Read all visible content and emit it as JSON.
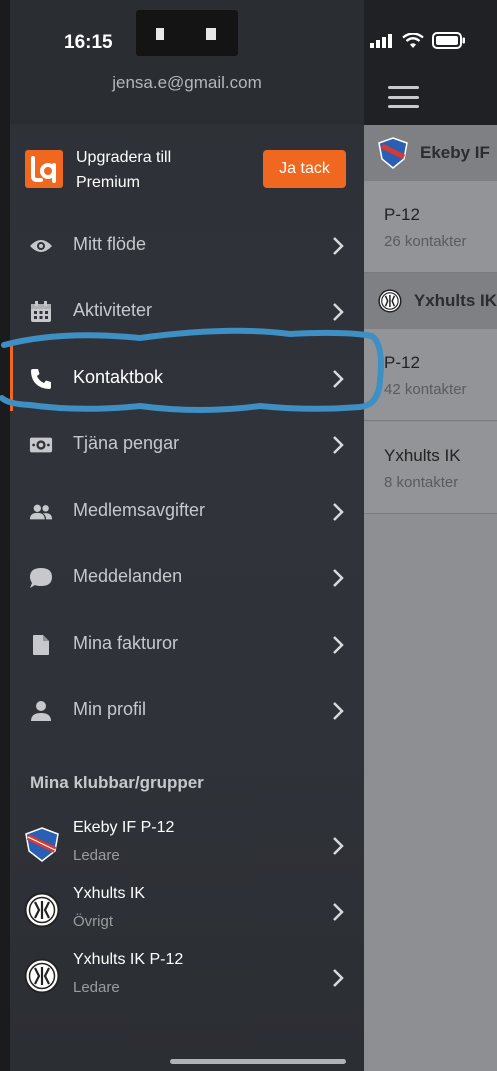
{
  "status_bar": {
    "time": "16:15"
  },
  "account": {
    "email": "jensa.e@gmail.com"
  },
  "premium": {
    "text": "Upgradera till Premium",
    "button_label": "Ja tack",
    "accent": "#f0671f"
  },
  "menu": {
    "items": [
      {
        "label": "Mitt flöde",
        "icon": "eye-icon"
      },
      {
        "label": "Aktiviteter",
        "icon": "calendar-icon"
      },
      {
        "label": "Kontaktbok",
        "icon": "phone-icon",
        "active": true
      },
      {
        "label": "Tjäna pengar",
        "icon": "money-icon"
      },
      {
        "label": "Medlemsavgifter",
        "icon": "people-icon"
      },
      {
        "label": "Meddelanden",
        "icon": "chat-bubble-icon"
      },
      {
        "label": "Mina fakturor",
        "icon": "document-icon"
      },
      {
        "label": "Min profil",
        "icon": "person-icon"
      }
    ]
  },
  "clubs_section": {
    "title": "Mina klubbar/grupper",
    "items": [
      {
        "name": "Ekeby IF P-12",
        "role": "Ledare",
        "icon": "ekeby-crest-icon"
      },
      {
        "name": "Yxhults IK",
        "role": "Övrigt",
        "icon": "yxhult-crest-icon"
      },
      {
        "name": "Yxhults IK P-12",
        "role": "Ledare",
        "icon": "yxhult-crest-icon"
      }
    ]
  },
  "contacts_panel": {
    "groups": [
      {
        "club": "Ekeby IF",
        "rows": [
          {
            "title": "P-12",
            "count": "26 kontakter"
          }
        ]
      },
      {
        "club": "Yxhults IK",
        "rows": [
          {
            "title": "P-12",
            "count": "42 kontakter"
          },
          {
            "title": "Yxhults IK",
            "count": "8 kontakter"
          }
        ]
      }
    ]
  },
  "annotation": {
    "color": "#3d8fc4",
    "marks": "Kontaktbok"
  }
}
